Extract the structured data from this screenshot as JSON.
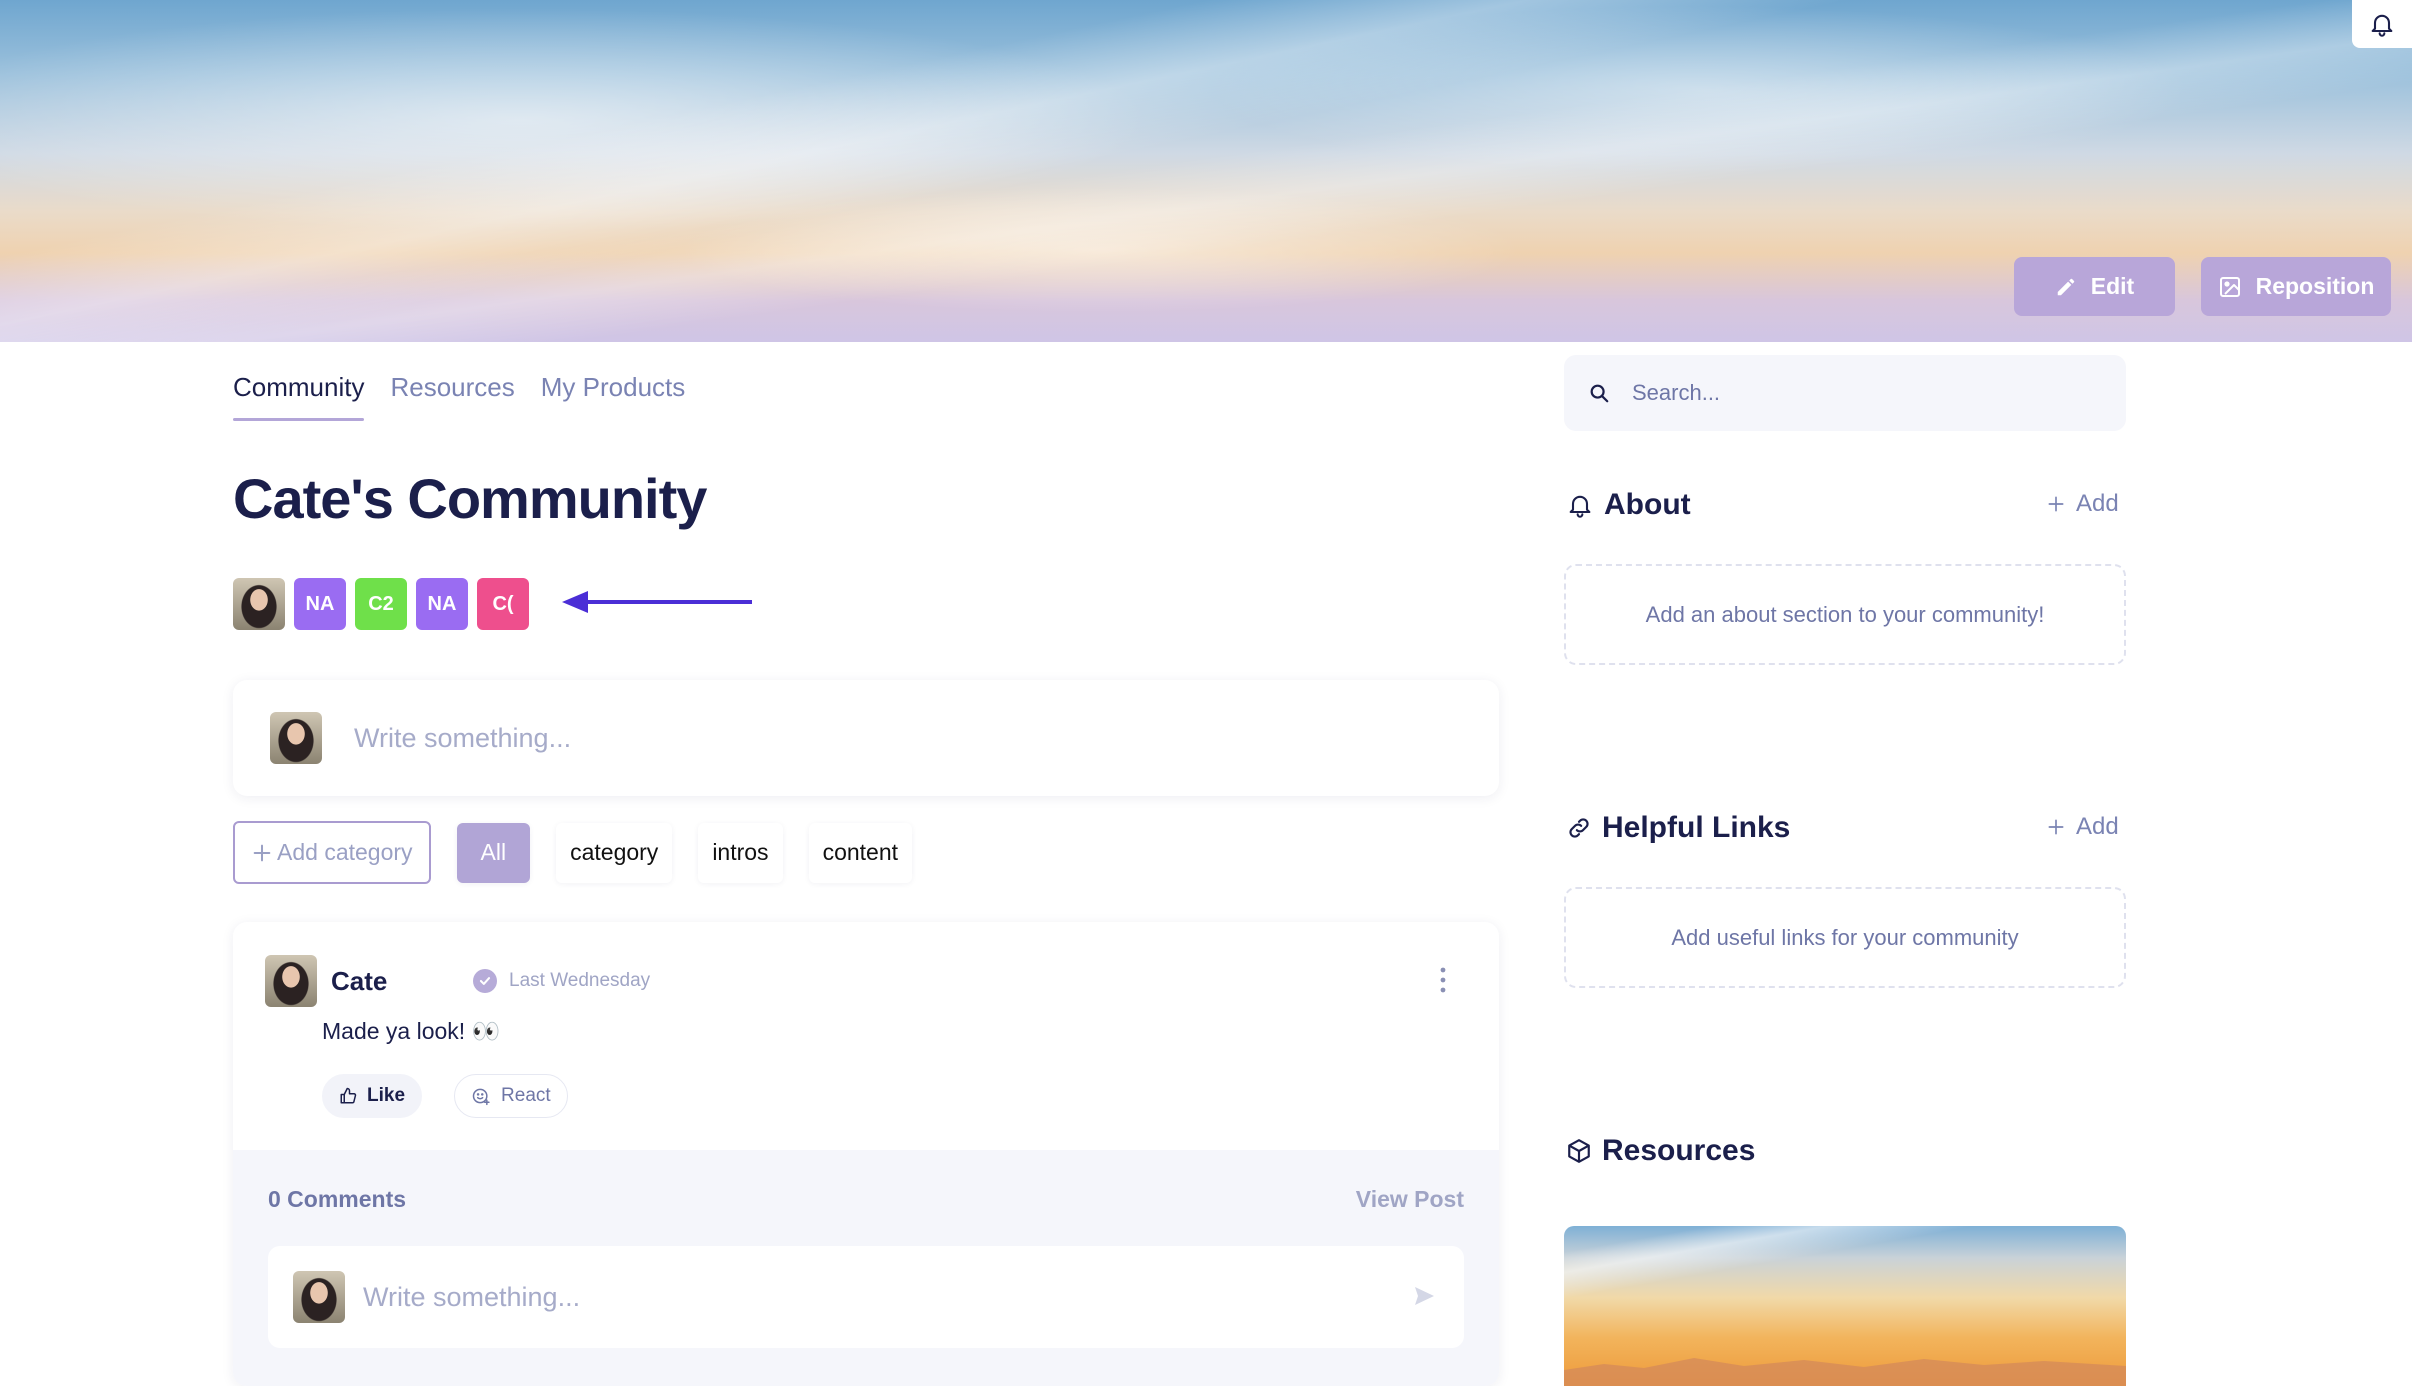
{
  "banner": {
    "edit_label": "Edit",
    "reposition_label": "Reposition",
    "bell_icon": "bell-icon"
  },
  "tabs": [
    {
      "label": "Community",
      "active": true
    },
    {
      "label": "Resources",
      "active": false
    },
    {
      "label": "My Products",
      "active": false
    }
  ],
  "page": {
    "title": "Cate's Community"
  },
  "members": [
    {
      "type": "photo",
      "label": ""
    },
    {
      "type": "initials",
      "label": "NA",
      "color": "#9a6cf2"
    },
    {
      "type": "initials",
      "label": "C2",
      "color": "#6fe04a"
    },
    {
      "type": "initials",
      "label": "NA",
      "color": "#9a6cf2"
    },
    {
      "type": "initials",
      "label": "C(",
      "color": "#ee4f8d"
    }
  ],
  "composer": {
    "placeholder": "Write something..."
  },
  "categories": {
    "add_label": "Add category",
    "items": [
      {
        "label": "All",
        "selected": true
      },
      {
        "label": "category",
        "selected": false
      },
      {
        "label": "intros",
        "selected": false
      },
      {
        "label": "content",
        "selected": false
      }
    ]
  },
  "post": {
    "author": "Cate",
    "time": "Last Wednesday",
    "body": "Made ya look! 👀",
    "like_label": "Like",
    "react_label": "React",
    "comments_label": "0 Comments",
    "view_post_label": "View Post",
    "comment_placeholder": "Write something..."
  },
  "sidebar": {
    "search_placeholder": "Search...",
    "about": {
      "title": "About",
      "add_label": "Add",
      "empty_text": "Add an about section to your community!"
    },
    "helpful_links": {
      "title": "Helpful Links",
      "add_label": "Add",
      "empty_text": "Add useful links for your community"
    },
    "resources": {
      "title": "Resources"
    }
  },
  "colors": {
    "accent": "#b8a6d9",
    "primary_text": "#1b1f4b",
    "muted_text": "#7a83b3",
    "arrow": "#4b2ed6"
  }
}
